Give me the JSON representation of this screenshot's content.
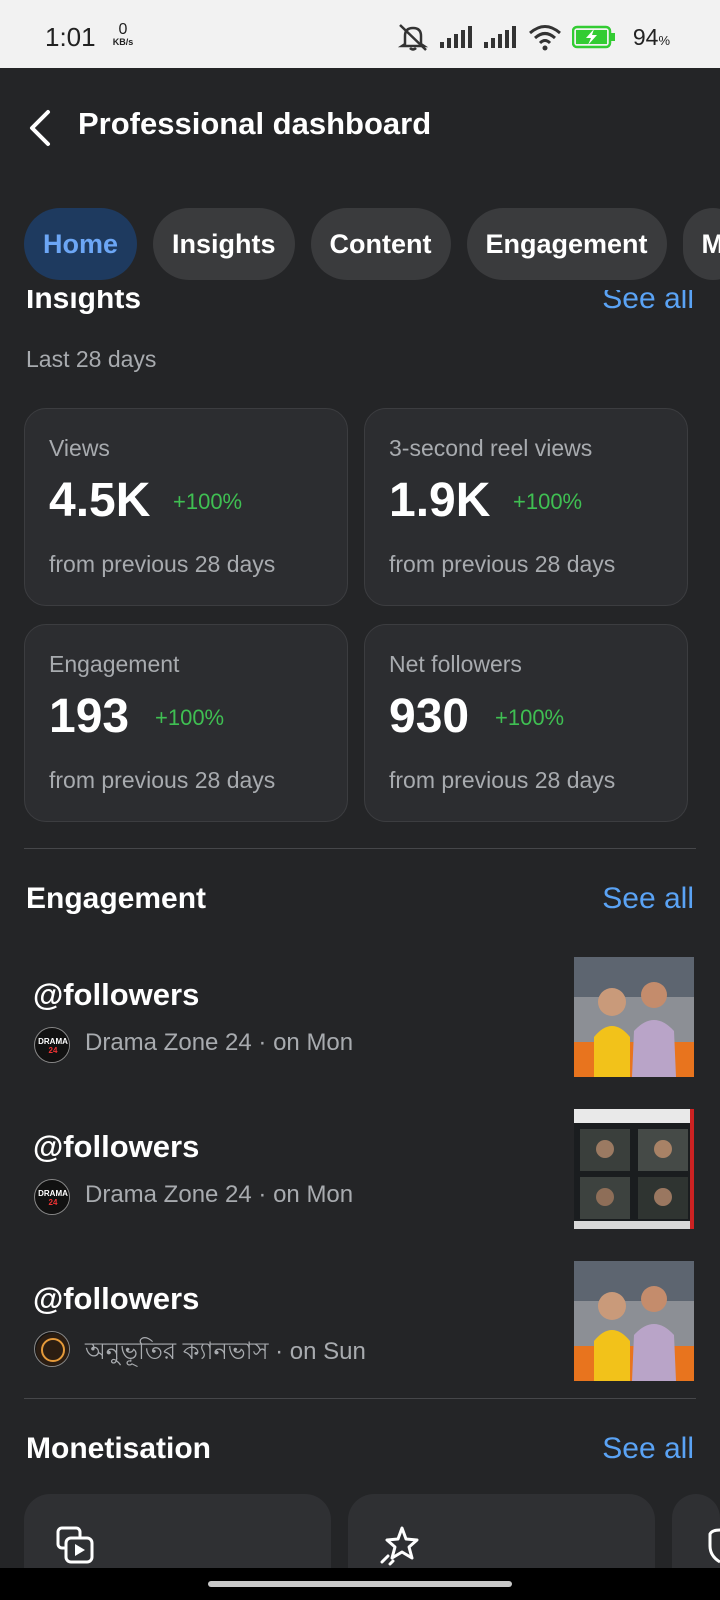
{
  "status": {
    "time": "1:01",
    "speed_value": "0",
    "speed_unit": "KB/s",
    "battery": "94",
    "battery_unit": "%"
  },
  "header": {
    "title": "Professional dashboard"
  },
  "tabs": [
    {
      "label": "Home",
      "active": true
    },
    {
      "label": "Insights"
    },
    {
      "label": "Content"
    },
    {
      "label": "Engagement"
    },
    {
      "label": "M"
    }
  ],
  "insights": {
    "title": "Insights",
    "see_all": "See all",
    "period": "Last 28 days",
    "cards": [
      {
        "label": "Views",
        "value": "4.5K",
        "delta": "+100%",
        "from": "from previous 28 days"
      },
      {
        "label": "3-second reel views",
        "value": "1.9K",
        "delta": "+100%",
        "from": "from previous 28 days"
      },
      {
        "label": "Engagement",
        "value": "193",
        "delta": "+100%",
        "from": "from previous 28 days"
      },
      {
        "label": "Net followers",
        "value": "930",
        "delta": "+100%",
        "from": "from previous 28 days"
      }
    ]
  },
  "engagement": {
    "title": "Engagement",
    "see_all": "See all",
    "items": [
      {
        "handle": "@followers",
        "meta": "Drama Zone 24 · on Mon",
        "avatar_icon": "drama-zone-logo-icon",
        "thumb": "couple-thumbnail"
      },
      {
        "handle": "@followers",
        "meta": "Drama Zone 24 · on Mon",
        "avatar_icon": "drama-zone-logo-icon",
        "thumb": "collage-thumbnail"
      },
      {
        "handle": "@followers",
        "meta": "অনুভূতির ক্যানভাস · on Sun",
        "avatar_icon": "canvas-logo-icon",
        "thumb": "couple-thumbnail"
      }
    ]
  },
  "monetisation": {
    "title": "Monetisation",
    "see_all": "See all",
    "cards": [
      {
        "icon": "video-photo-icon"
      },
      {
        "icon": "star-sparkle-icon"
      },
      {
        "icon": "shield-icon"
      }
    ]
  },
  "colors": {
    "background": "#242527",
    "accent": "#5aa3f5",
    "positive": "#3fbf52",
    "active_tab_bg": "#1e3a5f"
  }
}
